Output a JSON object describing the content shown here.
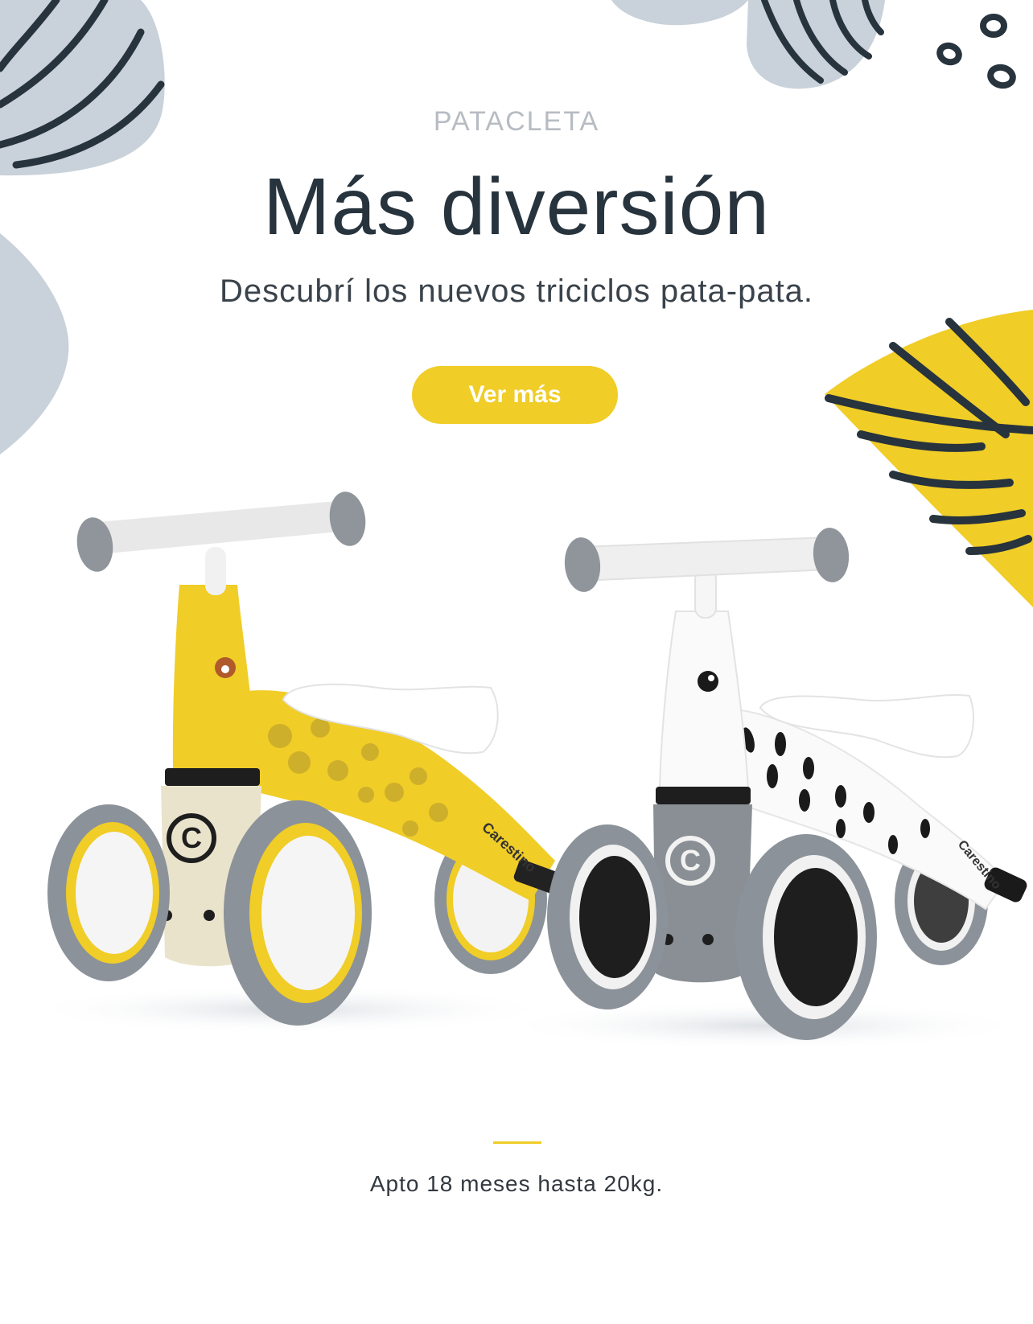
{
  "hero": {
    "eyebrow": "PATACLETA",
    "headline": "Más diversión",
    "subheadline": "Descubrí los nuevos triciclos pata-pata.",
    "cta_label": "Ver más"
  },
  "product": {
    "left_brand": "Carestino",
    "right_brand": "Carestino"
  },
  "footer": {
    "note": "Apto 18 meses hasta 20kg."
  },
  "colors": {
    "accent": "#f0cd27",
    "leaf_gray": "#c9d1da",
    "stripe_dark": "#27333d",
    "text_dark": "#27333d",
    "eyebrow_gray": "#b7bcc3"
  }
}
